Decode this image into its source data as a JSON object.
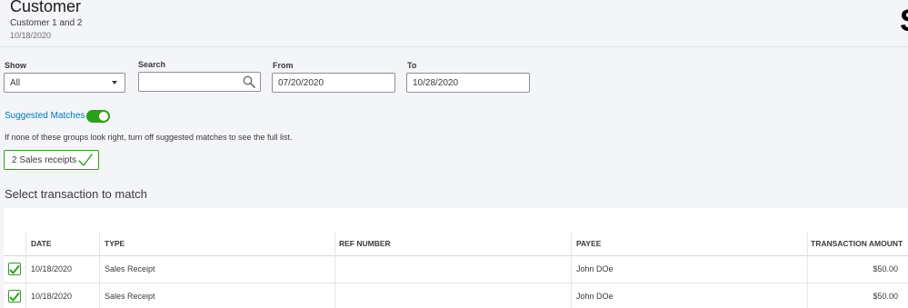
{
  "header": {
    "title": "Customer",
    "subtitle": "Customer 1 and 2",
    "date": "10/18/2020",
    "edge_glyph": "S"
  },
  "filters": {
    "show_label": "Show",
    "show_value": "All",
    "search_label": "Search",
    "search_value": "",
    "from_label": "From",
    "from_value": "07/20/2020",
    "to_label": "To",
    "to_value": "10/28/2020"
  },
  "suggested": {
    "label": "Suggested Matches",
    "enabled": true,
    "hint": "If none of these groups look right, turn off suggested matches to see the full list.",
    "chip_label": "2 Sales receipts"
  },
  "section_title": "Select transaction to match",
  "table": {
    "headers": {
      "date": "DATE",
      "type": "TYPE",
      "ref": "REF NUMBER",
      "payee": "PAYEE",
      "amount": "TRANSACTION AMOUNT"
    },
    "rows": [
      {
        "checked": true,
        "date": "10/18/2020",
        "type": "Sales Receipt",
        "ref": "",
        "payee": "John DOe",
        "amount": "$50.00"
      },
      {
        "checked": true,
        "date": "10/18/2020",
        "type": "Sales Receipt",
        "ref": "",
        "payee": "John DOe",
        "amount": "$50.00"
      }
    ]
  },
  "colors": {
    "accent_green": "#2ca01c",
    "link_blue": "#0077c5"
  }
}
